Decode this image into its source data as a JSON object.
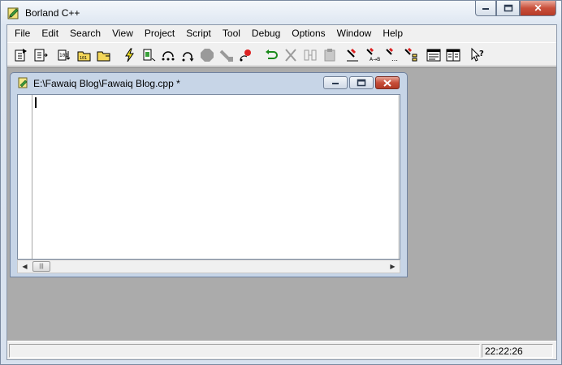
{
  "window": {
    "title": "Borland C++",
    "minimize_glyph": "▁",
    "maximize_glyph": "▢",
    "close_glyph": "✕"
  },
  "menubar": {
    "items": [
      "File",
      "Edit",
      "Search",
      "View",
      "Project",
      "Script",
      "Tool",
      "Debug",
      "Options",
      "Window",
      "Help"
    ]
  },
  "toolbar": {
    "buttons": [
      {
        "icon": "open-file-icon"
      },
      {
        "icon": "save-file-icon"
      },
      {
        "icon": "project-open-icon"
      },
      {
        "icon": "project-add-icon"
      },
      {
        "icon": "project-remove-icon"
      },
      {
        "icon": "lightning-run-icon"
      },
      {
        "icon": "compile-icon"
      },
      {
        "icon": "step-over-icon"
      },
      {
        "icon": "trace-into-icon"
      },
      {
        "icon": "stop-icon"
      },
      {
        "icon": "pause-icon"
      },
      {
        "icon": "breakpoint-icon"
      },
      {
        "icon": "undo-icon"
      },
      {
        "icon": "cut-icon"
      },
      {
        "icon": "copy-icon"
      },
      {
        "icon": "paste-icon"
      },
      {
        "icon": "find-icon"
      },
      {
        "icon": "replace-icon"
      },
      {
        "icon": "find-next-icon"
      },
      {
        "icon": "browse-icon"
      },
      {
        "icon": "window-list-icon"
      },
      {
        "icon": "split-window-icon"
      },
      {
        "icon": "help-pointer-icon"
      }
    ]
  },
  "child_window": {
    "title": "E:\\Fawaiq Blog\\Fawaiq Blog.cpp *"
  },
  "editor": {
    "content": "",
    "hscroll_thumb_glyph": "|||",
    "left_arrow": "◀",
    "right_arrow": "▶"
  },
  "statusbar": {
    "time": "22:22:26"
  },
  "colors": {
    "mdi_background": "#ababab",
    "close_button": "#c74e39"
  }
}
